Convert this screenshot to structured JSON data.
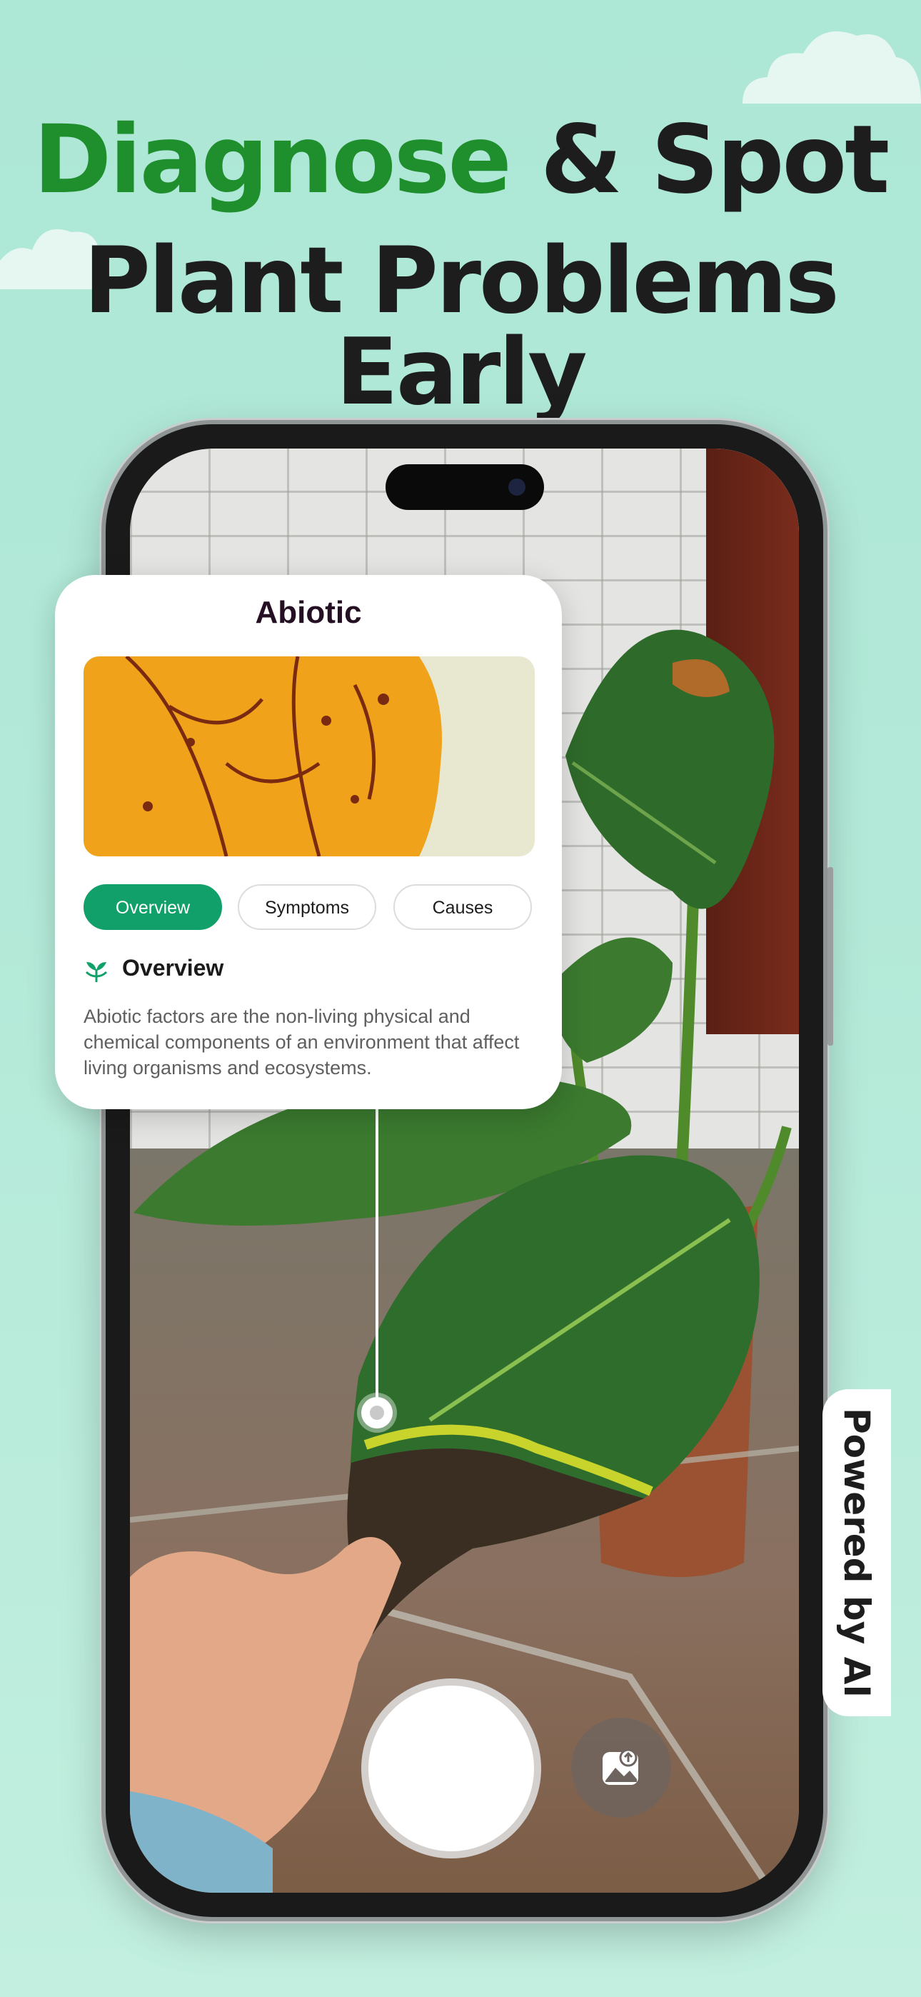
{
  "headline": {
    "line1_accent": "Diagnose",
    "line1_rest": "& Spot",
    "line2": "Plant Problems Early"
  },
  "card": {
    "title": "Abiotic",
    "tabs": [
      {
        "label": "Overview",
        "active": true
      },
      {
        "label": "Symptoms",
        "active": false
      },
      {
        "label": "Causes",
        "active": false
      }
    ],
    "section_title": "Overview",
    "section_text": "Abiotic factors are the non-living physical and chemical components of an environment that affect living organisms and ecosystems."
  },
  "badge": {
    "text": "Powered by AI"
  },
  "icons": [
    "sprout-icon",
    "gallery-upload-icon",
    "shutter-button"
  ],
  "colors": {
    "accent_green": "#1f8e2c",
    "tab_active": "#12a06a",
    "background": "#b3e9d8"
  }
}
